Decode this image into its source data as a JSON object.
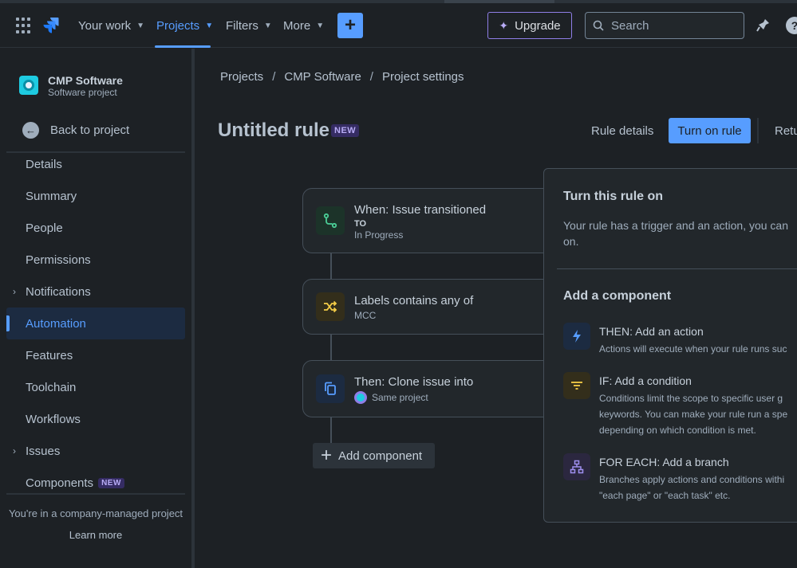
{
  "topnav": {
    "items": [
      {
        "label": "Your work",
        "active": false
      },
      {
        "label": "Projects",
        "active": true
      },
      {
        "label": "Filters",
        "active": false
      },
      {
        "label": "More",
        "active": false
      }
    ],
    "create_symbol": "+",
    "upgrade_label": "Upgrade",
    "search_placeholder": "Search",
    "help_symbol": "?"
  },
  "sidebar": {
    "project_name": "CMP Software",
    "project_type": "Software project",
    "back_label": "Back to project",
    "items": [
      {
        "label": "Details"
      },
      {
        "label": "Summary"
      },
      {
        "label": "People"
      },
      {
        "label": "Permissions"
      },
      {
        "label": "Notifications",
        "expandable": true
      },
      {
        "label": "Automation",
        "selected": true
      },
      {
        "label": "Features"
      },
      {
        "label": "Toolchain"
      },
      {
        "label": "Workflows"
      },
      {
        "label": "Issues",
        "expandable": true
      },
      {
        "label": "Components",
        "badge": "NEW"
      }
    ],
    "company_note": "You're in a company-managed project",
    "learn_more": "Learn more"
  },
  "breadcrumb": [
    "Projects",
    "CMP Software",
    "Project settings"
  ],
  "rule": {
    "title": "Untitled rule",
    "badge": "NEW",
    "details_label": "Rule details",
    "turn_on_label": "Turn on rule",
    "return_label": "Retu"
  },
  "flow": {
    "trigger": {
      "title": "When: Issue transitioned",
      "sub_label": "TO",
      "sub_value": "In Progress"
    },
    "condition": {
      "title": "Labels contains any of",
      "value": "MCC"
    },
    "action": {
      "title": "Then: Clone issue into",
      "value": "Same project"
    },
    "add_component_label": "Add component"
  },
  "panel": {
    "heading": "Turn this rule on",
    "description": "Your rule has a trigger and an action, you can",
    "description_2": "on.",
    "add_heading": "Add a component",
    "options": [
      {
        "title": "THEN: Add an action",
        "desc": [
          "Actions will execute when your rule runs suc"
        ]
      },
      {
        "title": "IF: Add a condition",
        "desc": [
          "Conditions limit the scope to specific user g",
          "keywords. You can make your rule run a spe",
          "depending on which condition is met."
        ]
      },
      {
        "title": "FOR EACH: Add a branch",
        "desc": [
          "Branches apply actions and conditions withi",
          "\"each page\" or \"each task\" etc."
        ]
      }
    ]
  },
  "colors": {
    "accent": "#579dff",
    "background": "#1d2125",
    "card": "#22272b",
    "new_badge_bg": "#352c63",
    "new_badge_text": "#b8acf6",
    "trigger_icon": "#4bce97",
    "condition_icon": "#f5cd47",
    "action_icon": "#579dff",
    "branch_icon": "#9f8fef"
  }
}
